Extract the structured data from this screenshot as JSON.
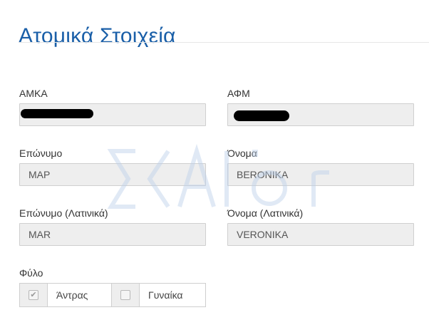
{
  "page": {
    "title": "Ατομικά Στοιχεία"
  },
  "fields": {
    "amka": {
      "label": "ΑΜΚΑ",
      "value": ""
    },
    "afm": {
      "label": "ΑΦΜ",
      "value": ""
    },
    "surname": {
      "label": "Επώνυμο",
      "value": "ΜΑΡ"
    },
    "name": {
      "label": "Όνομα",
      "value": "ΒΕRONIKA"
    },
    "surname_latin": {
      "label": "Επώνυμο (Λατινικά)",
      "value": "MAR"
    },
    "name_latin": {
      "label": "Όνομα (Λατινικά)",
      "value": "VERONIKA"
    }
  },
  "gender": {
    "label": "Φύλο",
    "options": [
      {
        "label": "Άντρας",
        "checked": true
      },
      {
        "label": "Γυναίκα",
        "checked": false
      }
    ]
  },
  "watermark": {
    "text": "ΣΧΑΙΟΙΓ"
  },
  "colors": {
    "title": "#1a5fa8",
    "field_bg": "#eeeeee",
    "field_border": "#cfcfcf",
    "redaction": "#000000"
  }
}
